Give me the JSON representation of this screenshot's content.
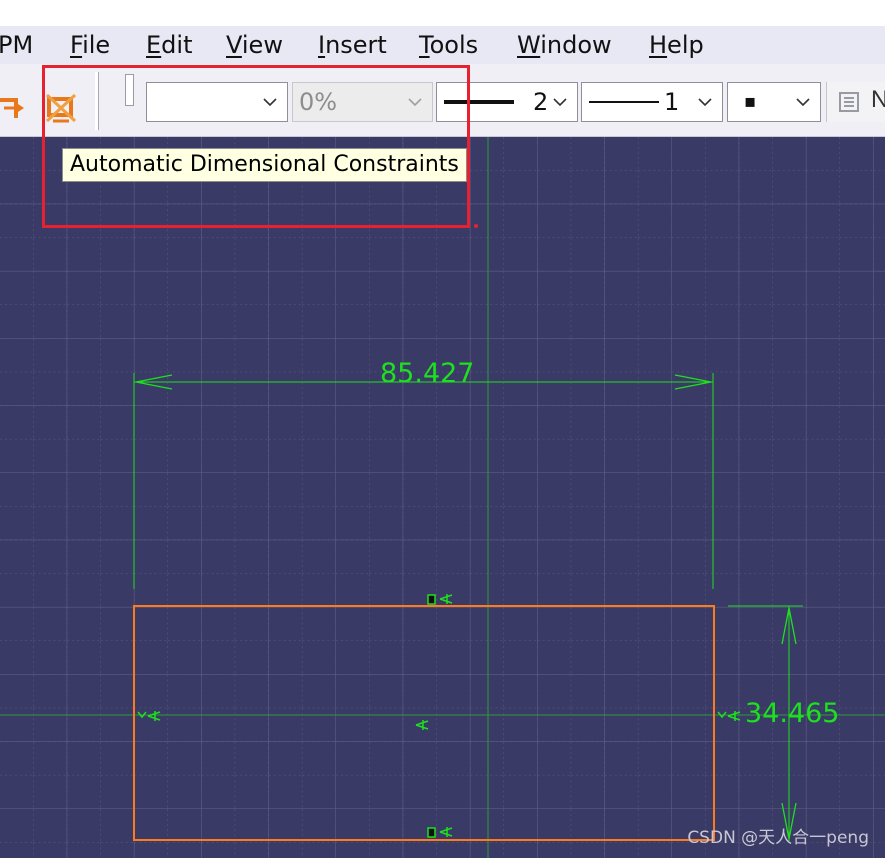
{
  "menu": {
    "items": [
      {
        "label": "PM",
        "mnemonic": ""
      },
      {
        "label": "File",
        "mnemonic": "F"
      },
      {
        "label": "Edit",
        "mnemonic": "E"
      },
      {
        "label": "View",
        "mnemonic": "V"
      },
      {
        "label": "Insert",
        "mnemonic": "I"
      },
      {
        "label": "Tools",
        "mnemonic": "T"
      },
      {
        "label": "Window",
        "mnemonic": "W"
      },
      {
        "label": "Help",
        "mnemonic": "H"
      }
    ]
  },
  "toolbar": {
    "icons": [
      "constraint-icon",
      "auto-dimensional-constraints-icon"
    ],
    "fill_combo_value": "",
    "transparency_value": "0%",
    "line_thickness_value": "2",
    "line_type_value": "1",
    "point_type_value": "▪",
    "partial_button_text": "N"
  },
  "tooltip": {
    "text": "Automatic Dimensional Constraints"
  },
  "sketch": {
    "horizontal_dimension": "85.427",
    "vertical_dimension": "34.465",
    "profile_color": "#ff7a1a",
    "dimension_color": "#1ee01e",
    "background_color": "#3a3a66"
  },
  "highlight_color": "#e62231",
  "watermark": "CSDN @天人合一peng"
}
